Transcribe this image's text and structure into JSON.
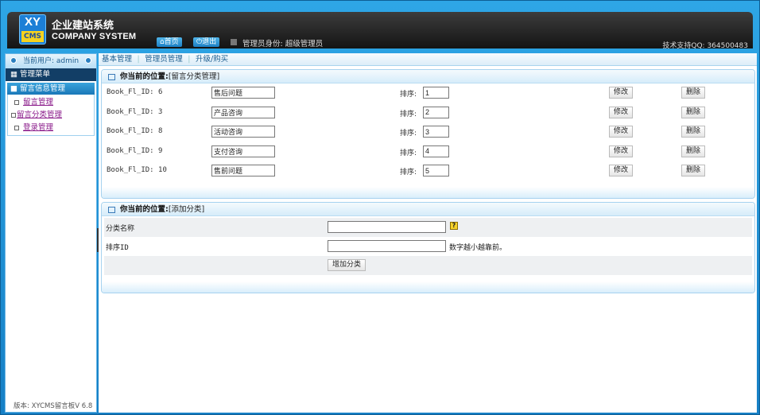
{
  "header": {
    "logo_top": "XY",
    "logo_bottom": "CMS",
    "title_cn": "企业建站系统",
    "title_en": "COMPANY SYSTEM",
    "home_label": "首页",
    "logout_label": "退出",
    "admin_identity": "管理员身份: 超级管理员",
    "support": "技术支持QQ: 364500483"
  },
  "sidebar": {
    "current_user": "当前用户: admin",
    "menu_title": "管理菜单",
    "group_title": "留言信息管理",
    "items": [
      {
        "label": "留言管理"
      },
      {
        "label": "留言分类管理"
      },
      {
        "label": "登录管理"
      }
    ],
    "version": "版本: XYCMS留言板V 6.8"
  },
  "topnav": {
    "items": [
      "基本管理",
      "管理员管理",
      "升级/购买"
    ]
  },
  "category_panel": {
    "location": "你当前的位置:",
    "location_value": "[留言分类管理]",
    "sort_label": "排序:",
    "edit_label": "修改",
    "delete_label": "删除",
    "rows": [
      {
        "id_text": "Book_Fl_ID: 6",
        "name": "售后问题",
        "sort": "1"
      },
      {
        "id_text": "Book_Fl_ID: 3",
        "name": "产品咨询",
        "sort": "2"
      },
      {
        "id_text": "Book_Fl_ID: 8",
        "name": "活动咨询",
        "sort": "3"
      },
      {
        "id_text": "Book_Fl_ID: 9",
        "name": "支付咨询",
        "sort": "4"
      },
      {
        "id_text": "Book_Fl_ID: 10",
        "name": "售前问题",
        "sort": "5"
      }
    ]
  },
  "add_panel": {
    "location": "你当前的位置:",
    "location_value": "[添加分类]",
    "name_label": "分类名称",
    "sort_label": "排序ID",
    "sort_hint": "数字越小越靠前。",
    "submit_label": "增加分类",
    "help_icon": "?"
  }
}
